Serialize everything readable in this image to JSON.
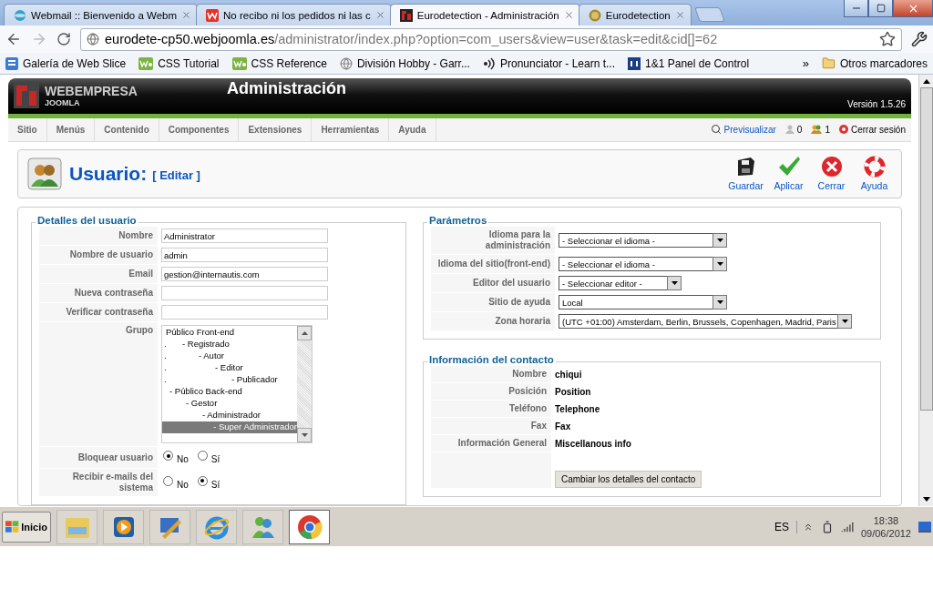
{
  "browser": {
    "tabs": [
      {
        "kind": "mail",
        "title": "Webmail :: Bienvenido a Webm",
        "selected": false
      },
      {
        "kind": "w",
        "title": "No recibo ni los pedidos ni las c",
        "selected": false
      },
      {
        "kind": "joomla",
        "title": "Eurodetection - Administración",
        "selected": true
      },
      {
        "kind": "site",
        "title": "Eurodetection",
        "selected": false
      }
    ],
    "address": {
      "host": "eurodete-cp50.webjoomla.es",
      "path": "/administrator/index.php?option=com_users&view=user&task=edit&cid[]=62"
    },
    "bookmarks": [
      {
        "kind": "slice",
        "label": "Galería de Web Slice"
      },
      {
        "kind": "w3",
        "label": "CSS Tutorial"
      },
      {
        "kind": "w3",
        "label": "CSS Reference"
      },
      {
        "kind": "globe",
        "label": "División Hobby - Garr..."
      },
      {
        "kind": "sound",
        "label": "Pronunciator - Learn t..."
      },
      {
        "kind": "oneandone",
        "label": "1&1 Panel de Control"
      }
    ],
    "overflow": "»",
    "other_bookmarks": "Otros marcadores"
  },
  "header": {
    "brand": "WEBEMPRESA",
    "brand_sub": "JOOMLA",
    "title": "Administración",
    "version": "Versión 1.5.26"
  },
  "menu": [
    "Sitio",
    "Menús",
    "Contenido",
    "Componentes",
    "Extensiones",
    "Herramientas",
    "Ayuda"
  ],
  "status": {
    "preview": "Previsualizar",
    "visitors": "0",
    "admins": "1",
    "logout": "Cerrar sesión"
  },
  "toolbar": {
    "title": "Usuario:",
    "subtitle": "[ Editar ]",
    "buttons": [
      {
        "kind": "save",
        "label": "Guardar"
      },
      {
        "kind": "apply",
        "label": "Aplicar"
      },
      {
        "kind": "close",
        "label": "Cerrar"
      },
      {
        "kind": "help",
        "label": "Ayuda"
      }
    ]
  },
  "user_details": {
    "legend": "Detalles del usuario",
    "fields": [
      {
        "label": "Nombre",
        "value": "Administrator"
      },
      {
        "label": "Nombre de usuario",
        "value": "admin"
      },
      {
        "label": "Email",
        "value": "gestion@internautis.com"
      },
      {
        "label": "Nueva contraseña"
      },
      {
        "label": "Verificar contraseña"
      }
    ],
    "group": {
      "label": "Grupo",
      "options": [
        {
          "label": "Público Front-end",
          "selected": false,
          "children": [
            {
              "lead": ".",
              "label": "- Registrado",
              "selected": false,
              "children": [
                {
                  "lead": ".",
                  "label": "- Autor",
                  "selected": false,
                  "children": [
                    {
                      "lead": ".",
                      "label": "- Editor",
                      "selected": false,
                      "children": [
                        {
                          "lead": ".",
                          "label": "- Publicador",
                          "selected": false
                        }
                      ]
                    }
                  ]
                }
              ]
            },
            {
              "label": "- Público Back-end",
              "selected": false,
              "children": [
                {
                  "label": "- Gestor",
                  "selected": false,
                  "children": [
                    {
                      "label": "- Administrador",
                      "selected": false,
                      "children": [
                        {
                          "label": "- Super Administrador",
                          "selected": true
                        }
                      ]
                    }
                  ]
                }
              ]
            }
          ]
        }
      ]
    },
    "radios": [
      {
        "label": "Bloquear usuario",
        "options": [
          {
            "label": "No",
            "selected": true
          },
          {
            "label": "Sí",
            "selected": false
          }
        ]
      },
      {
        "label": "Recibir e-mails del sistema",
        "options": [
          {
            "label": "No",
            "selected": false
          },
          {
            "label": "Sí",
            "selected": true
          }
        ]
      }
    ]
  },
  "parameters": {
    "legend": "Parámetros",
    "selects": [
      {
        "label": "Idioma para la administración",
        "value": "- Seleccionar el idioma -"
      },
      {
        "label": "Idioma del sitio(front-end)",
        "value": "- Seleccionar el idioma -"
      },
      {
        "label": "Editor del usuario",
        "value": "- Seleccionar editor -"
      },
      {
        "label": "Sitio de ayuda",
        "value": "Local"
      },
      {
        "label": "Zona horaria",
        "value": "(UTC +01:00) Amsterdam, Berlin, Brussels, Copenhagen, Madrid, Paris"
      }
    ]
  },
  "contact": {
    "legend": "Información del contacto",
    "rows": [
      {
        "label": "Nombre",
        "value": "chiqui"
      },
      {
        "label": "Posición",
        "value": "Position"
      },
      {
        "label": "Teléfono",
        "value": "Telephone"
      },
      {
        "label": "Fax",
        "value": "Fax"
      },
      {
        "label": "Información General",
        "value": "Miscellanous info"
      }
    ],
    "button": "Cambiar los detalles del contacto"
  },
  "taskbar": {
    "start": "Inicio",
    "apps": [
      {
        "kind": "folder",
        "selected": false
      },
      {
        "kind": "media",
        "selected": false
      },
      {
        "kind": "tool",
        "selected": false
      },
      {
        "kind": "ie",
        "selected": false
      },
      {
        "kind": "messenger",
        "selected": false
      },
      {
        "kind": "chrome",
        "selected": true
      }
    ],
    "language": "ES",
    "time": "18:38",
    "date": "09/06/2012"
  }
}
